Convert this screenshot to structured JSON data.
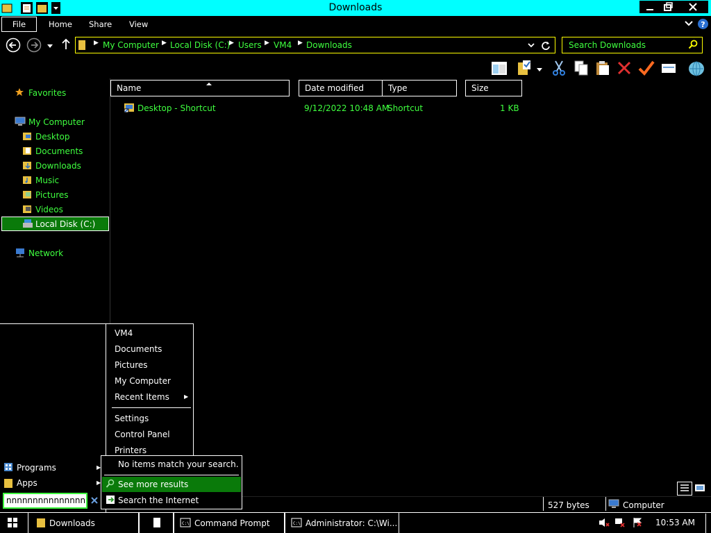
{
  "window": {
    "title": "Downloads",
    "colors": {
      "titlebar": "#00ffff",
      "hc_text": "#3fff3f",
      "hc_border": "#ffff00",
      "selection": "#0a7a0a"
    }
  },
  "ribbon": {
    "tabs": [
      "File",
      "Home",
      "Share",
      "View"
    ]
  },
  "address": {
    "breadcrumbs": [
      "My Computer",
      "Local Disk (C:)",
      "Users",
      "VM4",
      "Downloads"
    ],
    "search_placeholder": "Search Downloads"
  },
  "nav": {
    "favorites": "Favorites",
    "computer": "My Computer",
    "items": [
      "Desktop",
      "Documents",
      "Downloads",
      "Music",
      "Pictures",
      "Videos",
      "Local Disk (C:)"
    ],
    "network": "Network"
  },
  "columns": {
    "name": "Name",
    "date": "Date modified",
    "type": "Type",
    "size": "Size"
  },
  "files": [
    {
      "name": "Desktop - Shortcut",
      "date": "9/12/2022 10:48 AM",
      "type": "Shortcut",
      "size": "1 KB"
    }
  ],
  "status": {
    "size": "527 bytes",
    "location": "Computer"
  },
  "start_menu": {
    "places": [
      "VM4",
      "Documents",
      "Pictures",
      "My Computer",
      "Recent Items"
    ],
    "system": [
      "Settings",
      "Control Panel",
      "Printers"
    ],
    "left": [
      "Programs",
      "Apps"
    ],
    "search_text": "nnnnnnnnnnnnnnnnnnnn",
    "popup": {
      "no_results": "No items match your search.",
      "see_more": "See more results",
      "search_internet": "Search the Internet"
    }
  },
  "taskbar": {
    "tasks": [
      "Downloads",
      "Command Prompt",
      "Administrator: C:\\Wi..."
    ],
    "clock": "10:53 AM"
  }
}
